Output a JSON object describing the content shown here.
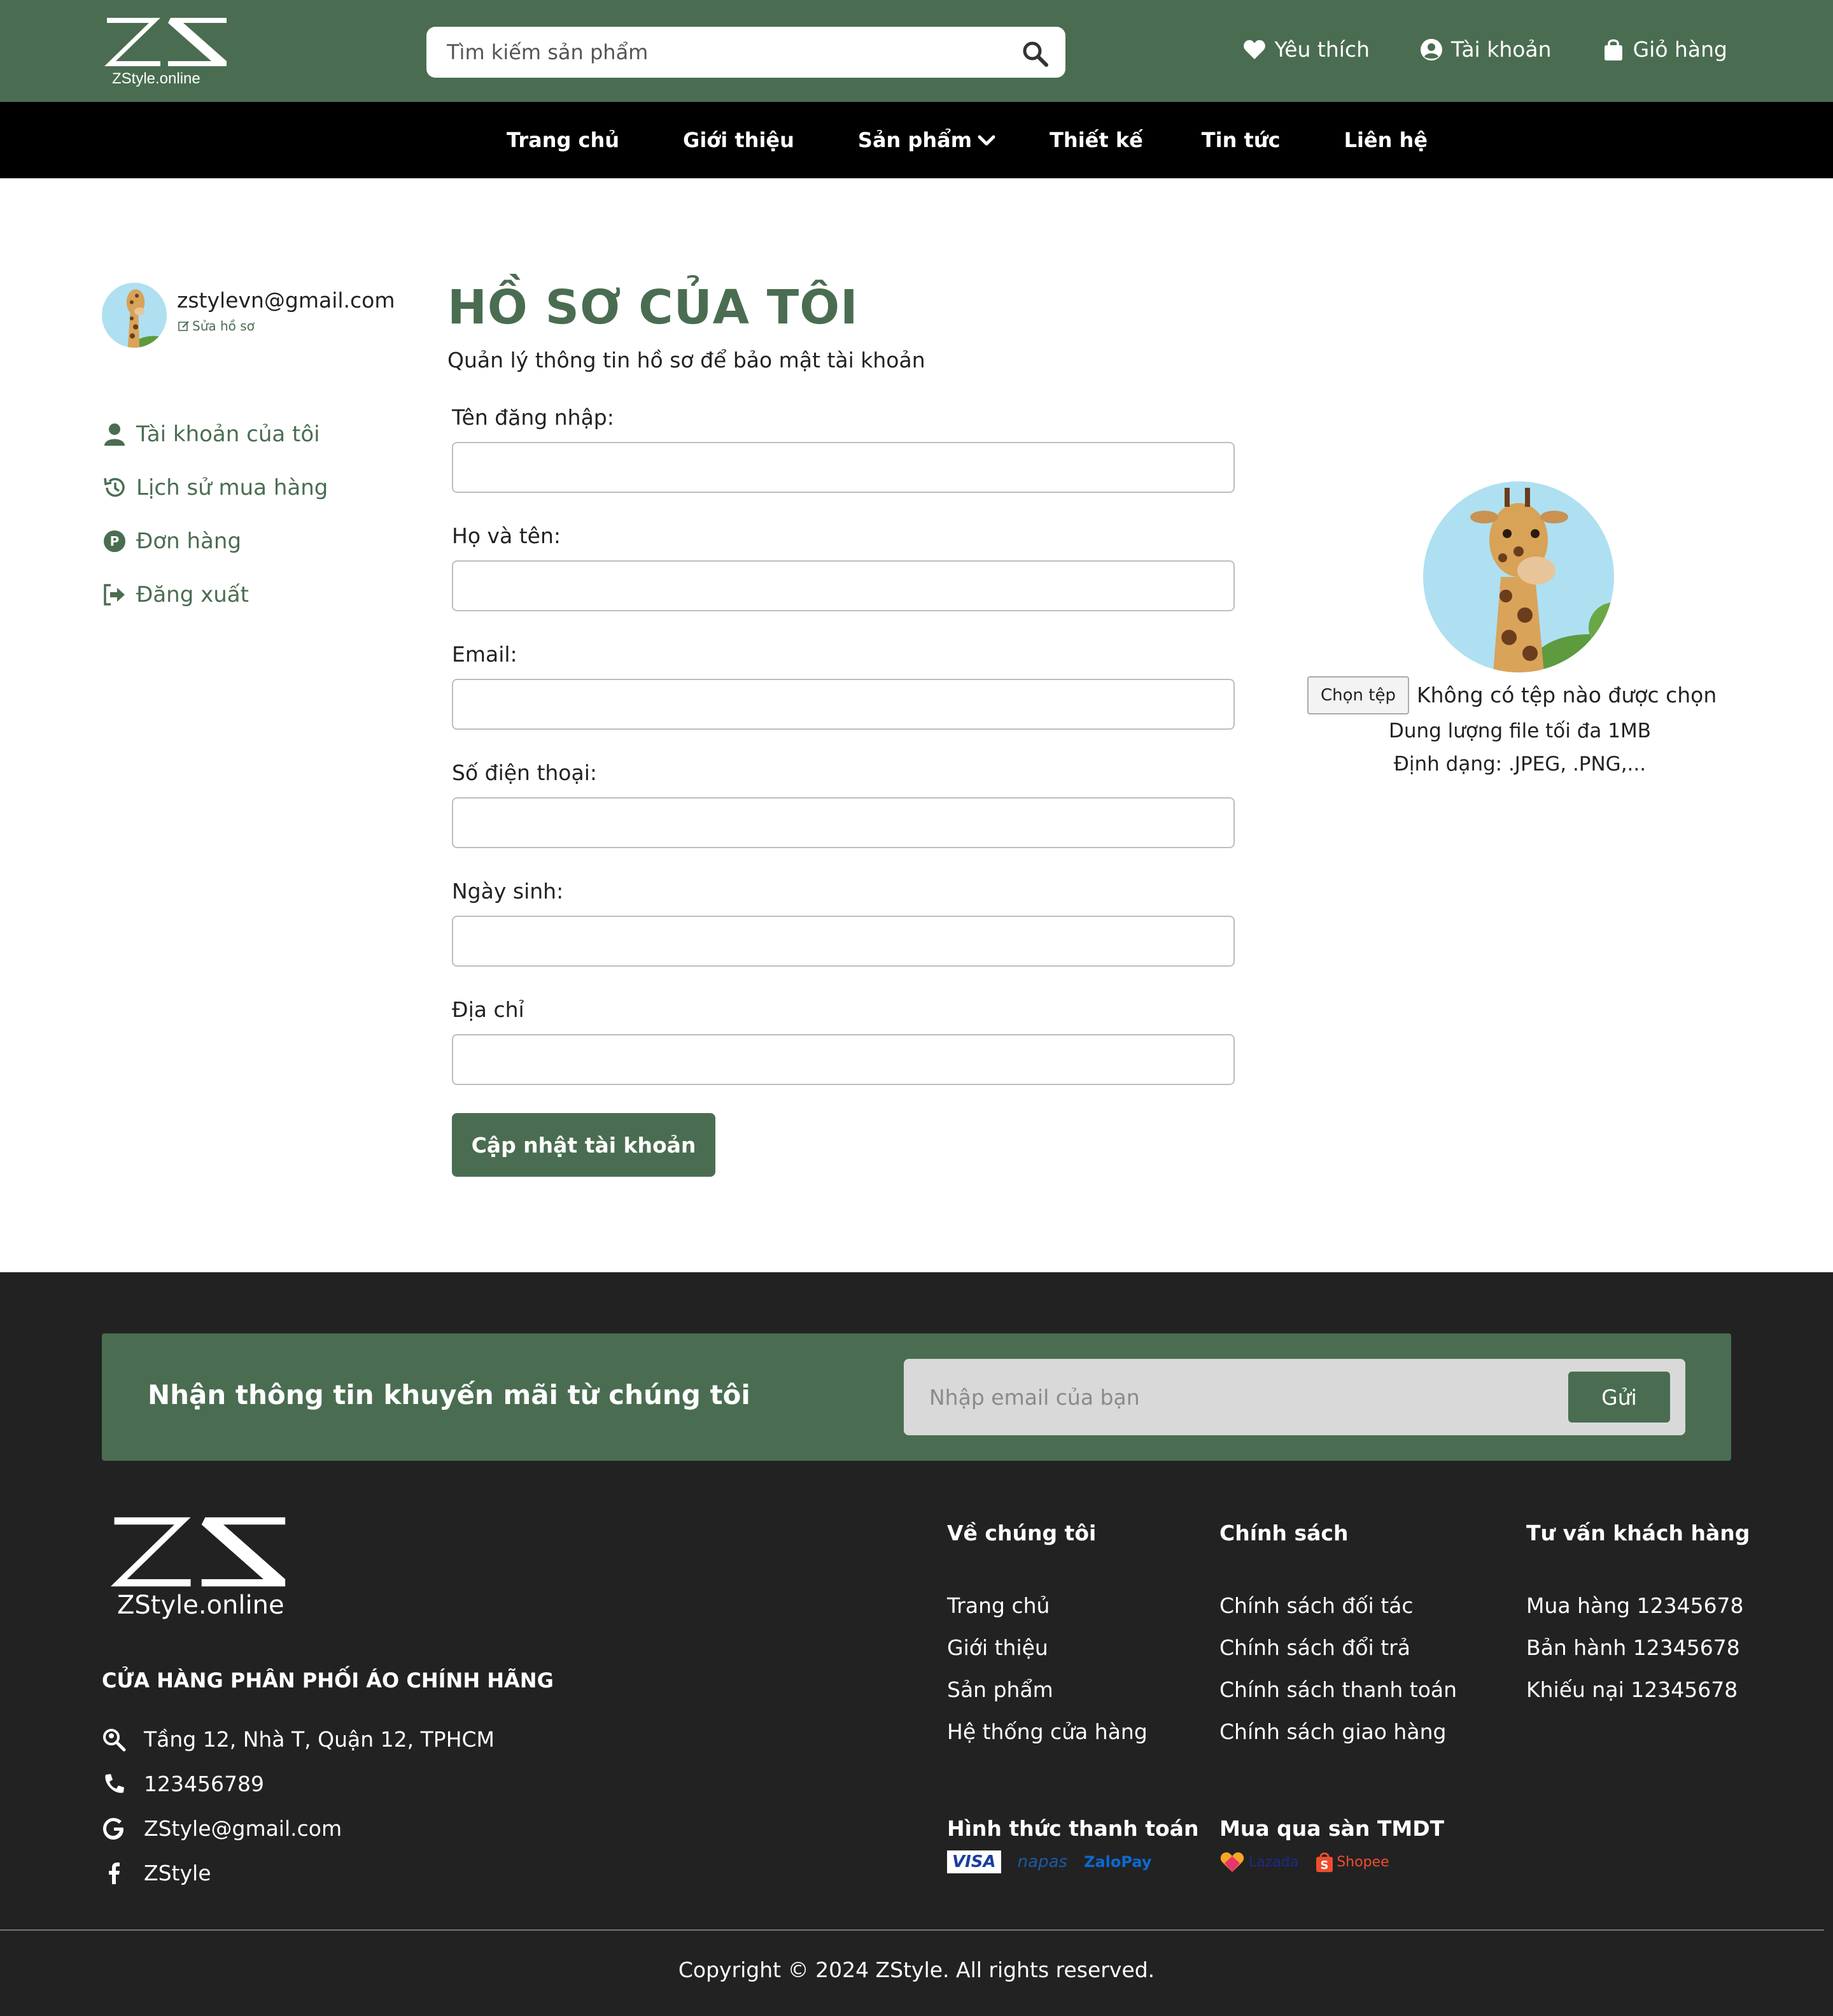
{
  "header": {
    "logo_text": "ZStyle.online",
    "search_placeholder": "Tìm kiếm sản phẩm",
    "links": [
      "Yêu thích",
      "Tài khoản",
      "Giỏ hàng"
    ]
  },
  "nav": {
    "items": [
      "Trang chủ",
      "Giới thiệu",
      "Sản phẩm",
      "Thiết kế",
      "Tin tức",
      "Liên hệ"
    ]
  },
  "sidebar": {
    "email": "zstylevn@gmail.com",
    "edit_label": "Sửa hồ sơ",
    "menu": [
      "Tài khoản của tôi",
      "Lịch sử mua hàng",
      "Đơn hàng",
      "Đăng xuất"
    ]
  },
  "profile": {
    "title": "HỒ SƠ CỦA TÔI",
    "subtitle": "Quản lý thông tin hồ sơ để bảo mật tài khoản",
    "fields": [
      {
        "label": "Tên đăng nhập:",
        "value": ""
      },
      {
        "label": "Họ và tên:",
        "value": ""
      },
      {
        "label": "Email:",
        "value": ""
      },
      {
        "label": "Số điện thoại:",
        "value": ""
      },
      {
        "label": "Ngày sinh:",
        "value": ""
      },
      {
        "label": "Địa chỉ",
        "value": ""
      }
    ],
    "submit_label": "Cập nhật tài khoản"
  },
  "avatar_panel": {
    "choose_file_label": "Chọn tệp",
    "file_status": "Không có tệp nào được chọn",
    "size_note": "Dung lượng file tối đa 1MB",
    "format_note": "Định dạng: .JPEG, .PNG,..."
  },
  "footer": {
    "newsletter_title": "Nhận thông tin khuyến mãi từ chúng tôi",
    "newsletter_placeholder": "Nhập email của bạn",
    "newsletter_button": "Gửi",
    "logo_text": "ZStyle.online",
    "tagline": "CỬA HÀNG PHÂN PHỐI ÁO CHÍNH HÃNG",
    "contacts": [
      "Tầng 12, Nhà T, Quận 12, TPHCM",
      "123456789",
      "ZStyle@gmail.com",
      "ZStyle"
    ],
    "columns": [
      {
        "title": "Về chúng tôi",
        "links": [
          "Trang chủ",
          "Giới thiệu",
          "Sản phẩm",
          "Hệ thống cửa hàng"
        ]
      },
      {
        "title": "Chính sách",
        "links": [
          "Chính sách đối tác",
          "Chính sách đổi trả",
          "Chính sách thanh toán",
          "Chính sách giao hàng"
        ]
      },
      {
        "title": "Tư vấn khách hàng",
        "links": [
          "Mua hàng 12345678",
          "Bản hành 12345678",
          "Khiếu nại 12345678"
        ]
      }
    ],
    "payment_title": "Hình thức thanh toán",
    "payment_methods": [
      "VISA",
      "napas",
      "ZaloPay"
    ],
    "marketplace_title": "Mua qua sàn TMDT",
    "marketplaces": [
      "Lazada",
      "Shopee"
    ],
    "copyright": "Copyright © 2024 ZStyle. All rights reserved."
  },
  "colors": {
    "brand_green": "#4a6d51",
    "nav_black": "#000000",
    "footer_dark": "#222222"
  }
}
